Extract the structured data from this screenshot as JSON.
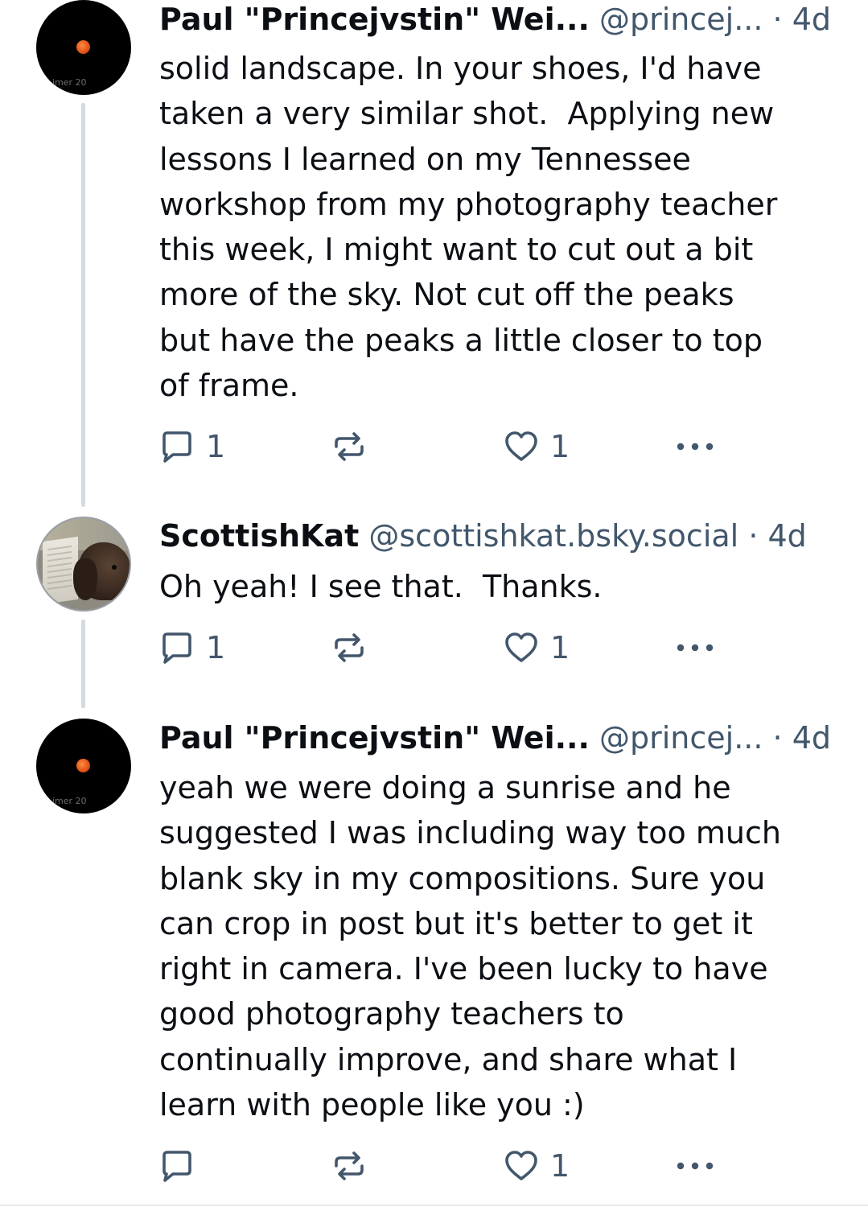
{
  "posts": [
    {
      "author": "Paul \"Princejvstin\" Wei...",
      "handle": "@princej...",
      "separator": "·",
      "time": "4d",
      "avatar_watermark": "imer 20",
      "text": "solid landscape. In your shoes, I'd have\ntaken a very similar shot.  Applying new\nlessons I learned on my Tennessee\nworkshop from my photography teacher\nthis week, I might want to cut out a bit\nmore of the sky. Not cut off the peaks\nbut have the peaks a little closer to top\nof frame.",
      "reply_count": "1",
      "like_count": "1"
    },
    {
      "author": "ScottishKat",
      "handle": "@scottishkat.bsky.social",
      "separator": "·",
      "time": "4d",
      "text": "Oh yeah! I see that.  Thanks.",
      "reply_count": "1",
      "like_count": "1"
    },
    {
      "author": "Paul \"Princejvstin\" Wei...",
      "handle": "@princej...",
      "separator": "·",
      "time": "4d",
      "avatar_watermark": "imer 20",
      "text": "yeah we were doing a sunrise and he\nsuggested I was including way too much\nblank sky in my compositions. Sure you\ncan crop in post but it's better to get it\nright in camera. I've been lucky to have\ngood photography teachers to\ncontinually improve, and share what I\nlearn with people like you :)",
      "reply_count": "",
      "like_count": "1"
    }
  ],
  "icons": {
    "reply": "speech-bubble-icon",
    "repost": "repost-arrows-icon",
    "like": "heart-icon",
    "more": "more-dots-icon"
  },
  "colors": {
    "text": "#0b0f14",
    "muted": "#42576c",
    "thread_line": "#d4dbe2"
  }
}
